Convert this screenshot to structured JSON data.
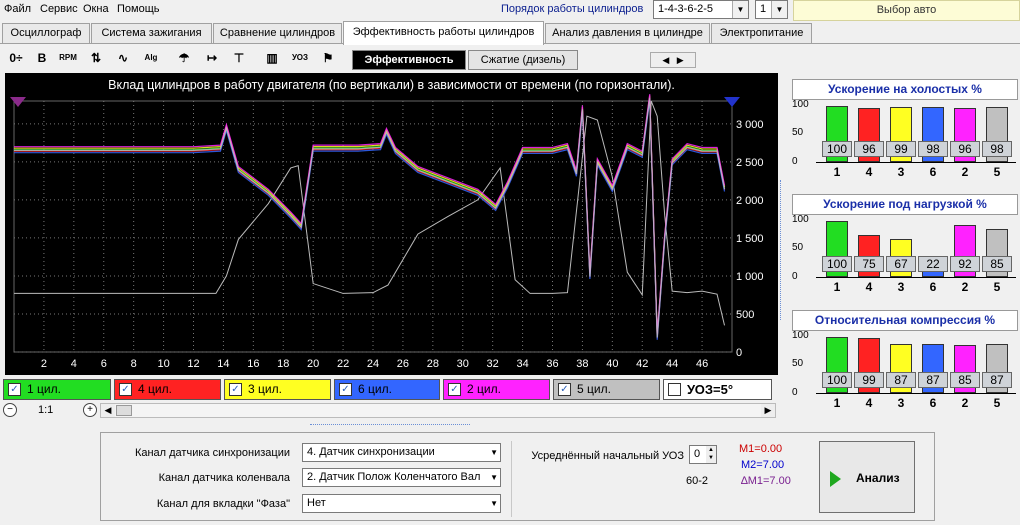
{
  "menu": {
    "items": [
      "Файл",
      "Сервис",
      "Окна",
      "Помощь"
    ],
    "order_label": "Порядок работы цилиндров",
    "order_value": "1-4-3-6-2-5",
    "bank_value": "1",
    "select_auto": "Выбор авто"
  },
  "tabs": [
    {
      "label": "Осциллограф"
    },
    {
      "label": "Система зажигания"
    },
    {
      "label": "Сравнение цилиндров"
    },
    {
      "label": "Эффективность работы цилиндров",
      "active": true
    },
    {
      "label": "Анализ давления в цилиндре"
    },
    {
      "label": "Электропитание"
    }
  ],
  "toolbar": {
    "icons": [
      "zoom-icon",
      "bold-icon",
      "rpm-icon",
      "scale-icon",
      "line-icon",
      "alg-icon",
      "marker-icon",
      "sort-icon",
      "filter-icon",
      "bars-icon",
      "uoz-icon",
      "flag-icon"
    ],
    "icon_glyphs": [
      "0÷",
      "B",
      "RPM",
      "⇅",
      "∿",
      "Alg",
      "☂",
      "↦",
      "⊤",
      "▥",
      "УОЗ",
      "⚑"
    ],
    "subtab_active": "Эффективность",
    "subtab_inactive": "Сжатие (дизель)"
  },
  "chart": {
    "title": "Вклад цилиндров в работу двигателя (по вертикали) в зависимости от времени (по горизонтали).",
    "x_ticks": [
      "2",
      "4",
      "6",
      "8",
      "10",
      "12",
      "14",
      "16",
      "18",
      "20",
      "22",
      "24",
      "26",
      "28",
      "30",
      "32",
      "34",
      "36",
      "38",
      "40",
      "42",
      "44",
      "46"
    ],
    "y_ticks": [
      "3 000",
      "2 500",
      "2 000",
      "1 500",
      "1 000",
      "500",
      "0"
    ],
    "colors": {
      "c1": "#22dd22",
      "c4": "#ff2222",
      "c3": "#ffff22",
      "c6": "#3366ff",
      "c2": "#ff22ff",
      "c5": "#c0c0c0"
    }
  },
  "chart_data": {
    "type": "line",
    "title": "Вклад цилиндров в работу двигателя (по вертикали) в зависимости от времени (по горизонтали).",
    "xlabel": "",
    "ylabel": "",
    "xlim": [
      0,
      48
    ],
    "ylim": [
      0,
      3300
    ],
    "grid": true,
    "series": [
      {
        "name": "rpm",
        "x": [
          0,
          12,
          13.5,
          14.2,
          15,
          17,
          18.5,
          19,
          20,
          22,
          24,
          25,
          27,
          29,
          31,
          32.5,
          33.5,
          34.5,
          36,
          37,
          38.3,
          39,
          40,
          41,
          42,
          42.6,
          43,
          43.5,
          44,
          45,
          46,
          47,
          47.5
        ],
        "y": [
          770,
          770,
          770,
          1000,
          1480,
          1950,
          2420,
          2450,
          900,
          770,
          780,
          880,
          1550,
          1780,
          2000,
          2420,
          950,
          770,
          770,
          780,
          3100,
          3050,
          2300,
          1050,
          750,
          3300,
          3100,
          1800,
          800,
          780,
          800,
          760,
          350
        ]
      },
      {
        "name": "efficiency",
        "x": [
          0,
          12,
          13.8,
          14.2,
          15,
          17,
          18.5,
          19.2,
          20,
          23,
          24.5,
          24.9,
          25.5,
          27,
          29,
          31,
          32.2,
          33,
          34,
          36,
          37,
          37.6,
          38,
          38.5,
          39,
          40,
          41,
          42,
          42.5,
          43,
          43.5,
          44,
          45,
          46,
          47,
          47.5
        ],
        "y": [
          2660,
          2660,
          2680,
          2950,
          2400,
          2100,
          1800,
          1650,
          2680,
          2680,
          2700,
          2900,
          2650,
          2400,
          2250,
          2100,
          1900,
          2200,
          2650,
          2650,
          2700,
          2350,
          3200,
          1000,
          2500,
          2150,
          2700,
          2600,
          3350,
          200,
          1500,
          2500,
          2700,
          2650,
          2650,
          2150
        ]
      }
    ]
  },
  "legend": [
    {
      "label": "1 цил.",
      "color": "#22dd22",
      "checked": "✓"
    },
    {
      "label": "4 цил.",
      "color": "#ff2222",
      "checked": "✓"
    },
    {
      "label": "3 цил.",
      "color": "#ffff22",
      "checked": "✓"
    },
    {
      "label": "6 цил.",
      "color": "#3366ff",
      "checked": "✓"
    },
    {
      "label": "2 цил.",
      "color": "#ff22ff",
      "checked": "✓"
    },
    {
      "label": "5 цил.",
      "color": "#c0c0c0",
      "checked": "✓"
    },
    {
      "label": "УОЗ=5°",
      "color": "#ffffff",
      "checked": ""
    }
  ],
  "zoom": {
    "label": "1:1",
    "minus": "−",
    "plus": "+",
    "left": "◀",
    "right": "▶"
  },
  "panels": [
    {
      "title": "Ускорение на холостых %",
      "cylinders": [
        "1",
        "4",
        "3",
        "6",
        "2",
        "5"
      ],
      "values": [
        100,
        96,
        99,
        98,
        96,
        98
      ],
      "labels": [
        "100",
        "96",
        "99",
        "98",
        "96",
        "98"
      ]
    },
    {
      "title": "Ускорение под нагрузкой %",
      "cylinders": [
        "1",
        "4",
        "3",
        "6",
        "2",
        "5"
      ],
      "values": [
        100,
        75,
        67,
        22,
        92,
        85
      ],
      "labels": [
        "100",
        "75",
        "67",
        "22",
        "92",
        "85"
      ]
    },
    {
      "title": "Относительная компрессия %",
      "cylinders": [
        "1",
        "4",
        "3",
        "6",
        "2",
        "5"
      ],
      "values": [
        100,
        99,
        87,
        87,
        85,
        87
      ],
      "labels": [
        "100",
        "99",
        "87",
        "87",
        "85",
        "87"
      ]
    }
  ],
  "panel_y_ticks": [
    "100",
    "50",
    "0"
  ],
  "bar_colors": [
    "#22dd22",
    "#ff2222",
    "#ffff22",
    "#3366ff",
    "#ff22ff",
    "#c0c0c0"
  ],
  "bottom": {
    "sync_label": "Канал датчика синхронизации",
    "sync_value": "4.  Датчик синхронизации",
    "crank_label": "Канал датчика коленвала",
    "crank_value": "2.  Датчик Полож Коленчатого Вал",
    "phase_label": "Канал для вкладки \"Фаза\"",
    "phase_value": "Нет",
    "uoz_label": "Усреднённый начальный УОЗ",
    "uoz_value": "0",
    "wheel": "60-2",
    "m1": "M1=0.00",
    "m2": "M2=7.00",
    "dm1": "∆M1=7.00",
    "m1_color": "#cc0000",
    "m2_color": "#0000cc",
    "dm1_color": "#7a2090",
    "analyze": "Анализ"
  }
}
